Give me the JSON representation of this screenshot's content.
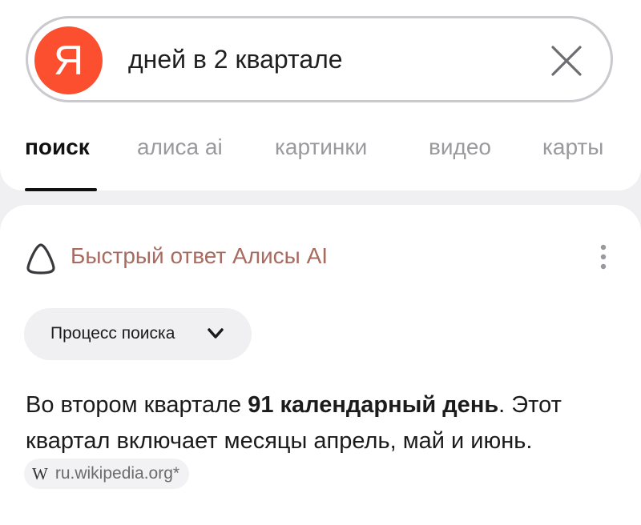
{
  "search": {
    "logo_letter": "Я",
    "query": "дней в 2 квартале",
    "logo_color": "#fc4f30"
  },
  "tabs": [
    {
      "label": "поиск",
      "active": true
    },
    {
      "label": "алиса ai",
      "active": false
    },
    {
      "label": "картинки",
      "active": false
    },
    {
      "label": "видео",
      "active": false
    },
    {
      "label": "карты",
      "active": false
    }
  ],
  "answer": {
    "header_label": "Быстрый ответ Алисы AI",
    "process_label": "Процесс поиска",
    "text_before": "Во втором квартале ",
    "text_bold": "91 календарный день",
    "text_after": ". Этот квартал включает месяцы апрель, май и июнь.",
    "source": "ru.wikipedia.org*",
    "source_icon_glyph": "W"
  },
  "icons": [
    "clear-icon",
    "alice-icon",
    "more-icon",
    "chevron-down-icon",
    "wikipedia-icon"
  ]
}
